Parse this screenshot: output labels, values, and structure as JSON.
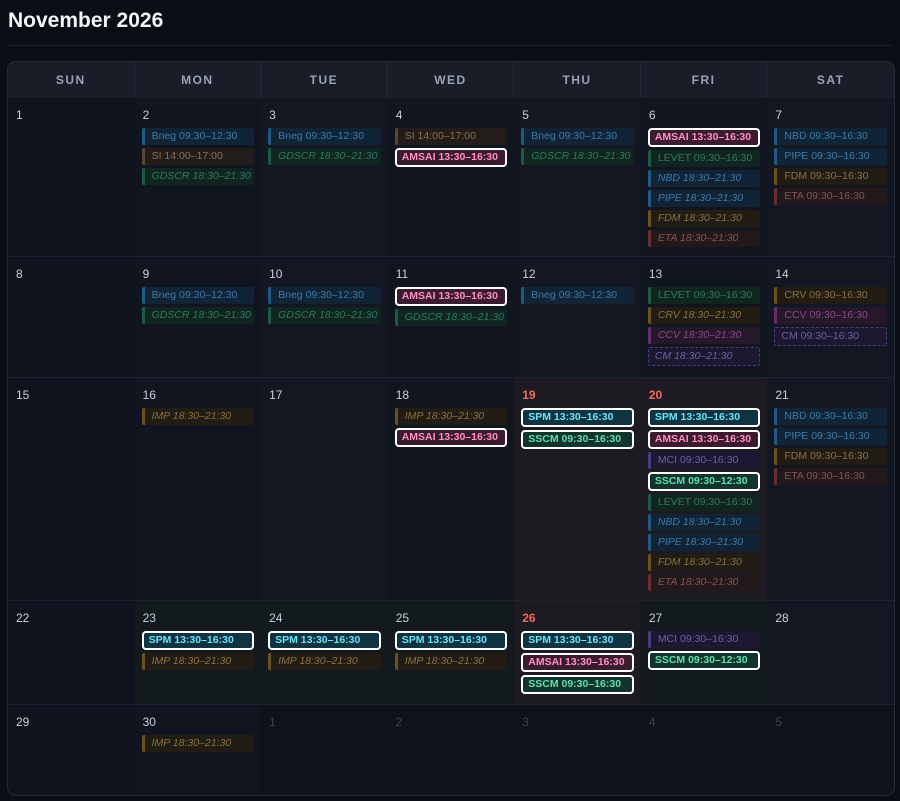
{
  "calendar": {
    "title": "November 2026",
    "weekdays": [
      "SUN",
      "MON",
      "TUE",
      "WED",
      "THU",
      "FRI",
      "SAT"
    ],
    "weeks": [
      [
        {
          "day": "1",
          "state": "current",
          "events": []
        },
        {
          "day": "2",
          "state": "current",
          "events": [
            {
              "label": "Bneg 09:30–12:30",
              "color": "blue"
            },
            {
              "label": "SI 14:00–17:00",
              "color": "brown"
            },
            {
              "label": "GDSCR 18:30–21:30",
              "color": "green",
              "italic": true
            }
          ]
        },
        {
          "day": "3",
          "state": "current",
          "events": [
            {
              "label": "Bneg 09:30–12:30",
              "color": "blue"
            },
            {
              "label": "GDSCR 18:30–21:30",
              "color": "green",
              "italic": true
            }
          ]
        },
        {
          "day": "4",
          "state": "current",
          "events": [
            {
              "label": "SI 14:00–17:00",
              "color": "brown"
            },
            {
              "label": "AMSAI 13:30–16:30",
              "color": "pink",
              "highlight": true
            }
          ]
        },
        {
          "day": "5",
          "state": "current",
          "events": [
            {
              "label": "Bneg 09:30–12:30",
              "color": "blue"
            },
            {
              "label": "GDSCR 18:30–21:30",
              "color": "green",
              "italic": true
            }
          ]
        },
        {
          "day": "6",
          "state": "current",
          "events": [
            {
              "label": "AMSAI 13:30–16:30",
              "color": "pink",
              "highlight": true
            },
            {
              "label": "LEVET 09:30–16:30",
              "color": "green"
            },
            {
              "label": "NBD 18:30–21:30",
              "color": "blue",
              "italic": true
            },
            {
              "label": "PIPE 18:30–21:30",
              "color": "blue",
              "italic": true
            },
            {
              "label": "FDM 18:30–21:30",
              "color": "amber",
              "italic": true
            },
            {
              "label": "ETA 18:30–21:30",
              "color": "red",
              "italic": true
            }
          ]
        },
        {
          "day": "7",
          "state": "current",
          "events": [
            {
              "label": "NBD 09:30–16:30",
              "color": "blue"
            },
            {
              "label": "PIPE 09:30–16:30",
              "color": "blue"
            },
            {
              "label": "FDM 09:30–16:30",
              "color": "amber"
            },
            {
              "label": "ETA 09:30–16:30",
              "color": "red"
            }
          ]
        }
      ],
      [
        {
          "day": "8",
          "state": "current",
          "events": []
        },
        {
          "day": "9",
          "state": "current",
          "events": [
            {
              "label": "Bneg 09:30–12:30",
              "color": "blue"
            },
            {
              "label": "GDSCR 18:30–21:30",
              "color": "green",
              "italic": true
            }
          ]
        },
        {
          "day": "10",
          "state": "current",
          "events": [
            {
              "label": "Bneg 09:30–12:30",
              "color": "blue"
            },
            {
              "label": "GDSCR 18:30–21:30",
              "color": "green",
              "italic": true
            }
          ]
        },
        {
          "day": "11",
          "state": "current",
          "events": [
            {
              "label": "AMSAI 13:30–16:30",
              "color": "pink",
              "highlight": true
            },
            {
              "label": "GDSCR 18:30–21:30",
              "color": "green",
              "italic": true
            }
          ]
        },
        {
          "day": "12",
          "state": "current",
          "events": [
            {
              "label": "Bneg 09:30–12:30",
              "color": "blue"
            }
          ]
        },
        {
          "day": "13",
          "state": "current",
          "events": [
            {
              "label": "LEVET 09:30–16:30",
              "color": "green"
            },
            {
              "label": "CRV 18:30–21:30",
              "color": "amber",
              "italic": true
            },
            {
              "label": "CCV 18:30–21:30",
              "color": "magenta",
              "italic": true
            },
            {
              "label": "CM 18:30–21:30",
              "color": "purple",
              "italic": true,
              "dashed": true
            }
          ]
        },
        {
          "day": "14",
          "state": "current",
          "events": [
            {
              "label": "CRV 09:30–16:30",
              "color": "amber"
            },
            {
              "label": "CCV 09:30–16:30",
              "color": "magenta"
            },
            {
              "label": "CM 09:30–16:30",
              "color": "purple",
              "dashed": true
            }
          ]
        }
      ],
      [
        {
          "day": "15",
          "state": "current",
          "events": []
        },
        {
          "day": "16",
          "state": "current",
          "events": [
            {
              "label": "IMP 18:30–21:30",
              "color": "amber",
              "italic": true
            }
          ]
        },
        {
          "day": "17",
          "state": "current",
          "events": []
        },
        {
          "day": "18",
          "state": "current",
          "events": [
            {
              "label": "IMP 18:30–21:30",
              "color": "amber",
              "italic": true
            },
            {
              "label": "AMSAI 13:30–16:30",
              "color": "pink",
              "highlight": true
            }
          ]
        },
        {
          "day": "19",
          "state": "today",
          "events": [
            {
              "label": "SPM 13:30–16:30",
              "color": "cyan",
              "highlight": true
            },
            {
              "label": "SSCM 09:30–16:30",
              "color": "mint",
              "highlight": true
            }
          ]
        },
        {
          "day": "20",
          "state": "today",
          "events": [
            {
              "label": "SPM 13:30–16:30",
              "color": "cyan",
              "highlight": true
            },
            {
              "label": "AMSAI 13:30–16:30",
              "color": "pink",
              "highlight": true
            },
            {
              "label": "MCI 09:30–16:30",
              "color": "purple"
            },
            {
              "label": "SSCM 09:30–12:30",
              "color": "mint",
              "highlight": true
            },
            {
              "label": "LEVET 09:30–16:30",
              "color": "green"
            },
            {
              "label": "NBD 18:30–21:30",
              "color": "blue",
              "italic": true
            },
            {
              "label": "PIPE 18:30–21:30",
              "color": "blue",
              "italic": true
            },
            {
              "label": "FDM 18:30–21:30",
              "color": "amber",
              "italic": true
            },
            {
              "label": "ETA 18:30–21:30",
              "color": "red",
              "italic": true
            }
          ]
        },
        {
          "day": "21",
          "state": "current",
          "events": [
            {
              "label": "NBD 09:30–16:30",
              "color": "blue"
            },
            {
              "label": "PIPE 09:30–16:30",
              "color": "blue"
            },
            {
              "label": "FDM 09:30–16:30",
              "color": "amber"
            },
            {
              "label": "ETA 09:30–16:30",
              "color": "red"
            }
          ]
        }
      ],
      [
        {
          "day": "22",
          "state": "current",
          "events": []
        },
        {
          "day": "23",
          "state": "current",
          "events": [
            {
              "label": "SPM 13:30–16:30",
              "color": "cyan",
              "highlight": true
            },
            {
              "label": "IMP 18:30–21:30",
              "color": "amber",
              "italic": true
            }
          ]
        },
        {
          "day": "24",
          "state": "current",
          "events": [
            {
              "label": "SPM 13:30–16:30",
              "color": "cyan",
              "highlight": true
            },
            {
              "label": "IMP 18:30–21:30",
              "color": "amber",
              "italic": true
            }
          ]
        },
        {
          "day": "25",
          "state": "current",
          "events": [
            {
              "label": "SPM 13:30–16:30",
              "color": "cyan",
              "highlight": true
            },
            {
              "label": "IMP 18:30–21:30",
              "color": "amber",
              "italic": true
            }
          ]
        },
        {
          "day": "26",
          "state": "today",
          "events": [
            {
              "label": "SPM 13:30–16:30",
              "color": "cyan",
              "highlight": true
            },
            {
              "label": "AMSAI 13:30–16:30",
              "color": "pink",
              "highlight": true
            },
            {
              "label": "SSCM 09:30–16:30",
              "color": "mint",
              "highlight": true
            }
          ]
        },
        {
          "day": "27",
          "state": "current",
          "events": [
            {
              "label": "MCI 09:30–16:30",
              "color": "purple"
            },
            {
              "label": "SSCM 09:30–12:30",
              "color": "mint",
              "highlight": true
            }
          ]
        },
        {
          "day": "28",
          "state": "current",
          "events": []
        }
      ],
      [
        {
          "day": "29",
          "state": "current",
          "events": []
        },
        {
          "day": "30",
          "state": "current",
          "events": [
            {
              "label": "IMP 18:30–21:30",
              "color": "amber",
              "italic": true
            }
          ]
        },
        {
          "day": "1",
          "state": "other",
          "events": []
        },
        {
          "day": "2",
          "state": "other",
          "events": []
        },
        {
          "day": "3",
          "state": "other",
          "events": []
        },
        {
          "day": "4",
          "state": "other",
          "events": []
        },
        {
          "day": "5",
          "state": "other",
          "events": []
        }
      ]
    ]
  },
  "palette": {
    "blue": {
      "bg": "#102436",
      "border": "#1f5a80",
      "text": "#3d7aa6"
    },
    "brown": {
      "bg": "#221d1a",
      "border": "#5a4631",
      "text": "#8a6f52"
    },
    "green": {
      "bg": "#102420",
      "border": "#1f5a48",
      "text": "#2f7a60"
    },
    "amber": {
      "bg": "#211d15",
      "border": "#6a5220",
      "text": "#8a7040"
    },
    "red": {
      "bg": "#22191b",
      "border": "#6a2e30",
      "text": "#8a4f50"
    },
    "magenta": {
      "bg": "#241829",
      "border": "#6a2c6a",
      "text": "#8a4a8a"
    },
    "purple": {
      "bg": "#1b1830",
      "border": "#4a3a80",
      "text": "#6f5ea6"
    },
    "pink": {
      "bg": "#3b1c2e",
      "border": "#e879b0",
      "text": "#ff8fc3"
    },
    "cyan": {
      "bg": "#0f3340",
      "border": "#3fd4ef",
      "text": "#6ee2f7"
    },
    "mint": {
      "bg": "#12342c",
      "border": "#36c494",
      "text": "#5fe0b0"
    }
  }
}
